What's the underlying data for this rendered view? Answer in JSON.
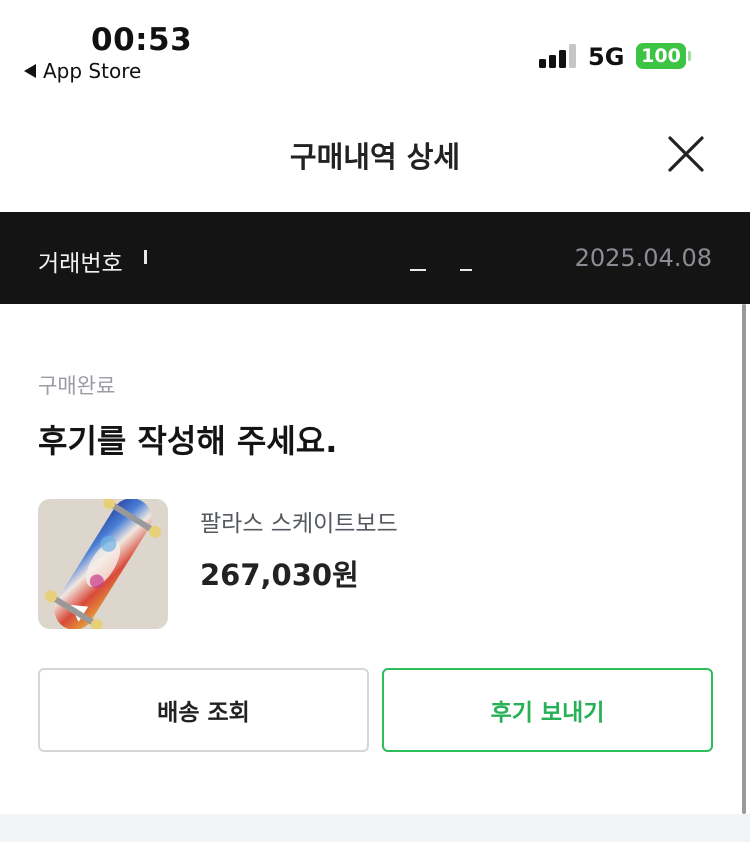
{
  "status_bar": {
    "time": "00:53",
    "back_app": "App Store",
    "network": "5G",
    "battery": "100"
  },
  "header": {
    "title": "구매내역 상세",
    "close_icon": "close-icon"
  },
  "transaction": {
    "label": "거래번호",
    "number_hidden": "",
    "date": "2025.04.08"
  },
  "order": {
    "status": "구매완료",
    "headline": "후기를 작성해 주세요.",
    "product": {
      "name": "팔라스 스케이트보드",
      "price": "267,030원",
      "image_icon": "skateboard-image"
    }
  },
  "actions": {
    "shipping_label": "배송 조회",
    "review_label": "후기 보내기"
  },
  "colors": {
    "accent_green": "#27b157",
    "battery_green": "#3ec444",
    "dark_bar": "#141414"
  }
}
